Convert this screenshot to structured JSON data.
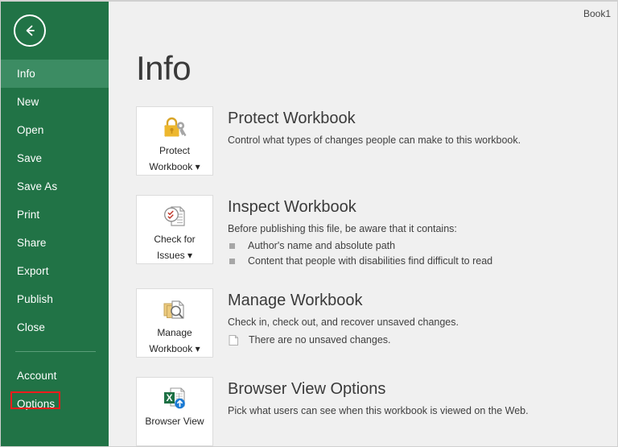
{
  "window": {
    "workbook_name": "Book1"
  },
  "sidebar": {
    "back_label": "Back",
    "back_icon": "back-arrow-icon",
    "items": [
      {
        "label": "Info",
        "active": true,
        "annotated": false
      },
      {
        "label": "New",
        "active": false,
        "annotated": false
      },
      {
        "label": "Open",
        "active": false,
        "annotated": false
      },
      {
        "label": "Save",
        "active": false,
        "annotated": false
      },
      {
        "label": "Save As",
        "active": false,
        "annotated": false
      },
      {
        "label": "Print",
        "active": false,
        "annotated": false
      },
      {
        "label": "Share",
        "active": false,
        "annotated": false
      },
      {
        "label": "Export",
        "active": false,
        "annotated": false
      },
      {
        "label": "Publish",
        "active": false,
        "annotated": false
      },
      {
        "label": "Close",
        "active": false,
        "annotated": false
      }
    ],
    "footer_items": [
      {
        "label": "Account",
        "active": false,
        "annotated": false
      },
      {
        "label": "Options",
        "active": false,
        "annotated": true
      }
    ],
    "colors": {
      "background": "#217346",
      "active_background": "#3c8c63",
      "text": "#ffffff",
      "divider": "#5a9e79"
    }
  },
  "main": {
    "title": "Info",
    "sections": {
      "protect": {
        "button_label_line1": "Protect",
        "button_label_line2": "Workbook",
        "button_icon": "lock-and-key-icon",
        "has_dropdown": true,
        "heading": "Protect Workbook",
        "description": "Control what types of changes people can make to this workbook."
      },
      "inspect": {
        "button_label_line1": "Check for",
        "button_label_line2": "Issues",
        "button_icon": "document-inspect-icon",
        "has_dropdown": true,
        "heading": "Inspect Workbook",
        "description": "Before publishing this file, be aware that it contains:",
        "bullets": [
          "Author's name and absolute path",
          "Content that people with disabilities find difficult to read"
        ]
      },
      "manage": {
        "button_label_line1": "Manage",
        "button_label_line2": "Workbook",
        "button_icon": "documents-magnifier-icon",
        "has_dropdown": true,
        "heading": "Manage Workbook",
        "description": "Check in, check out, and recover unsaved changes.",
        "note_icon": "page-icon",
        "note": "There are no unsaved changes."
      },
      "browser": {
        "button_label_line1": "Browser View",
        "button_label_line2": "",
        "button_icon": "excel-upload-icon",
        "has_dropdown": false,
        "heading": "Browser View Options",
        "description": "Pick what users can see when this workbook is viewed on the Web."
      }
    }
  },
  "annotation": {
    "color": "#ef1c1c",
    "target": "Options"
  }
}
